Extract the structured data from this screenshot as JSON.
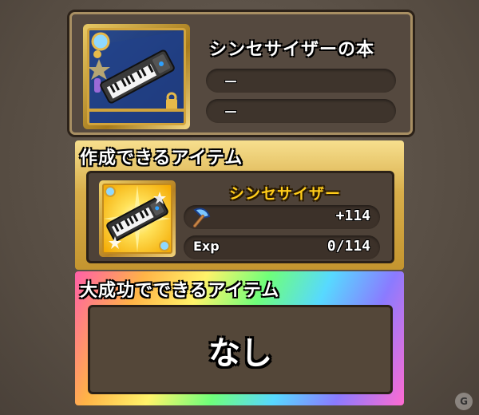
{
  "book": {
    "name": "シンセサイザーの本",
    "line1": "－",
    "line2": "－",
    "icon": "synthesizer-book-icon"
  },
  "craftable": {
    "section_label": "作成できるアイテム",
    "item_name": "シンセサイザー",
    "item_icon": "synthesizer-icon",
    "attack_icon": "axe-icon",
    "attack_value": "+114",
    "exp_label": "Exp",
    "exp_value": "0/114"
  },
  "great_success": {
    "section_label": "大成功でできるアイテム",
    "none_text": "なし"
  },
  "colors": {
    "item_name": "#ffcc1a",
    "gold_frame": "#d8ae4a",
    "panel_bg": "#4e4238"
  }
}
